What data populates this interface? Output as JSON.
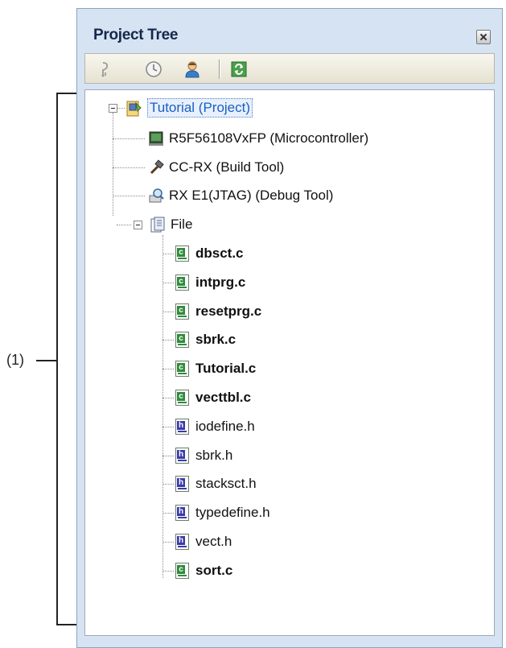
{
  "callout": {
    "label": "(1)"
  },
  "panel": {
    "title": "Project Tree",
    "toolbar": {
      "buttons": [
        {
          "icon": "add-item-icon",
          "tooltip": ""
        },
        {
          "icon": "clock-icon",
          "tooltip": ""
        },
        {
          "icon": "user-icon",
          "tooltip": ""
        },
        {
          "icon": "refresh-icon",
          "tooltip": ""
        }
      ]
    }
  },
  "tree": {
    "project": {
      "label": "Tutorial (Project)",
      "expanded": true,
      "selected": true
    },
    "top_nodes": [
      {
        "label": "R5F56108VxFP (Microcontroller)",
        "icon": "microcontroller-icon"
      },
      {
        "label": "CC-RX (Build Tool)",
        "icon": "build-tool-icon"
      },
      {
        "label": "RX E1(JTAG) (Debug Tool)",
        "icon": "debug-tool-icon"
      }
    ],
    "file_folder": {
      "label": "File",
      "expanded": true
    },
    "files": [
      {
        "label": "dbsct.c",
        "type": "c",
        "bold": true
      },
      {
        "label": "intprg.c",
        "type": "c",
        "bold": true
      },
      {
        "label": "resetprg.c",
        "type": "c",
        "bold": true
      },
      {
        "label": "sbrk.c",
        "type": "c",
        "bold": true
      },
      {
        "label": "Tutorial.c",
        "type": "c",
        "bold": true
      },
      {
        "label": "vecttbl.c",
        "type": "c",
        "bold": true
      },
      {
        "label": "iodefine.h",
        "type": "h",
        "bold": false
      },
      {
        "label": "sbrk.h",
        "type": "h",
        "bold": false
      },
      {
        "label": "stacksct.h",
        "type": "h",
        "bold": false
      },
      {
        "label": "typedefine.h",
        "type": "h",
        "bold": false
      },
      {
        "label": "vect.h",
        "type": "h",
        "bold": false
      },
      {
        "label": "sort.c",
        "type": "c",
        "bold": true
      }
    ]
  },
  "colors": {
    "panel_bg": "#d6e3f3",
    "c_file_accent": "#2e8b3a",
    "h_file_accent": "#3a3aa8",
    "selection_text": "#1a5fc2"
  }
}
